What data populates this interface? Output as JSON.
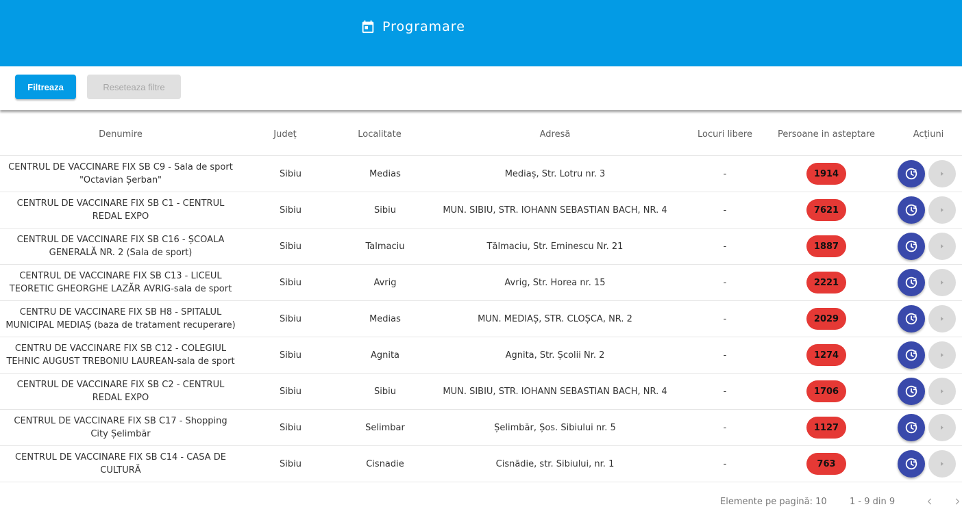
{
  "header": {
    "title": "Programare",
    "icon": "calendar-icon"
  },
  "filters": {
    "filter_label": "Filtreaza",
    "reset_label": "Reseteaza filtre"
  },
  "table": {
    "columns": [
      "Denumire",
      "Județ",
      "Localitate",
      "Adresă",
      "Locuri libere",
      "Persoane in asteptare",
      "Acțiuni"
    ],
    "rows": [
      {
        "name_l1": "CENTRUL DE VACCINARE FIX SB C9 - Sala de sport",
        "name_l2": "\"Octavian Șerban\"",
        "judet": "Sibiu",
        "localitate": "Medias",
        "adresa": "Mediaș, Str. Lotru nr. 3",
        "libere": "-",
        "asteptare": "1914"
      },
      {
        "name_l1": "CENTRUL DE VACCINARE FIX SB C1 - CENTRUL",
        "name_l2": "REDAL EXPO",
        "judet": "Sibiu",
        "localitate": "Sibiu",
        "adresa": "MUN. SIBIU, STR. IOHANN SEBASTIAN BACH, NR. 4",
        "libere": "-",
        "asteptare": "7621"
      },
      {
        "name_l1": "CENTRUL DE VACCINARE FIX SB C16 - ȘCOALA",
        "name_l2": "GENERALĂ NR. 2 (Sala de sport)",
        "judet": "Sibiu",
        "localitate": "Talmaciu",
        "adresa": "Tălmaciu, Str. Eminescu Nr. 21",
        "libere": "-",
        "asteptare": "1887"
      },
      {
        "name_l1": "CENTRUL DE VACCINARE FIX SB C13 - LICEUL",
        "name_l2": "TEORETIC GHEORGHE LAZĂR AVRIG-sala de sport",
        "judet": "Sibiu",
        "localitate": "Avrig",
        "adresa": "Avrig, Str. Horea nr. 15",
        "libere": "-",
        "asteptare": "2221"
      },
      {
        "name_l1": "CENTRU DE VACCINARE FIX SB H8 - SPITALUL",
        "name_l2": "MUNICIPAL MEDIAȘ (baza de tratament recuperare)",
        "judet": "Sibiu",
        "localitate": "Medias",
        "adresa": "MUN. MEDIAȘ, STR. CLOȘCA, NR. 2",
        "libere": "-",
        "asteptare": "2029"
      },
      {
        "name_l1": "CENTRU DE VACCINARE FIX SB C12 - COLEGIUL",
        "name_l2": "TEHNIC AUGUST TREBONIU LAUREAN-sala de sport",
        "judet": "Sibiu",
        "localitate": "Agnita",
        "adresa": "Agnita, Str. Școlii Nr. 2",
        "libere": "-",
        "asteptare": "1274"
      },
      {
        "name_l1": "CENTRUL DE VACCINARE FIX SB C2 - CENTRUL",
        "name_l2": "REDAL EXPO",
        "judet": "Sibiu",
        "localitate": "Sibiu",
        "adresa": "MUN. SIBIU, STR. IOHANN SEBASTIAN BACH, NR. 4",
        "libere": "-",
        "asteptare": "1706"
      },
      {
        "name_l1": "CENTRUL DE VACCINARE FIX SB C17 - Shopping",
        "name_l2": "City Șelimbăr",
        "judet": "Sibiu",
        "localitate": "Selimbar",
        "adresa": "Șelimbăr, Șos. Sibiului nr. 5",
        "libere": "-",
        "asteptare": "1127"
      },
      {
        "name_l1": "CENTRUL DE VACCINARE FIX SB C14 - CASA DE",
        "name_l2": "CULTURĂ",
        "judet": "Sibiu",
        "localitate": "Cisnadie",
        "adresa": "Cisnădie, str. Sibiului, nr. 1",
        "libere": "-",
        "asteptare": "763"
      }
    ]
  },
  "paginator": {
    "per_page_label": "Elemente pe pagină: 10",
    "range_label": "1 - 9 din 9"
  },
  "colors": {
    "primary": "#039be5",
    "badge": "#e53935",
    "action": "#3949ab"
  }
}
